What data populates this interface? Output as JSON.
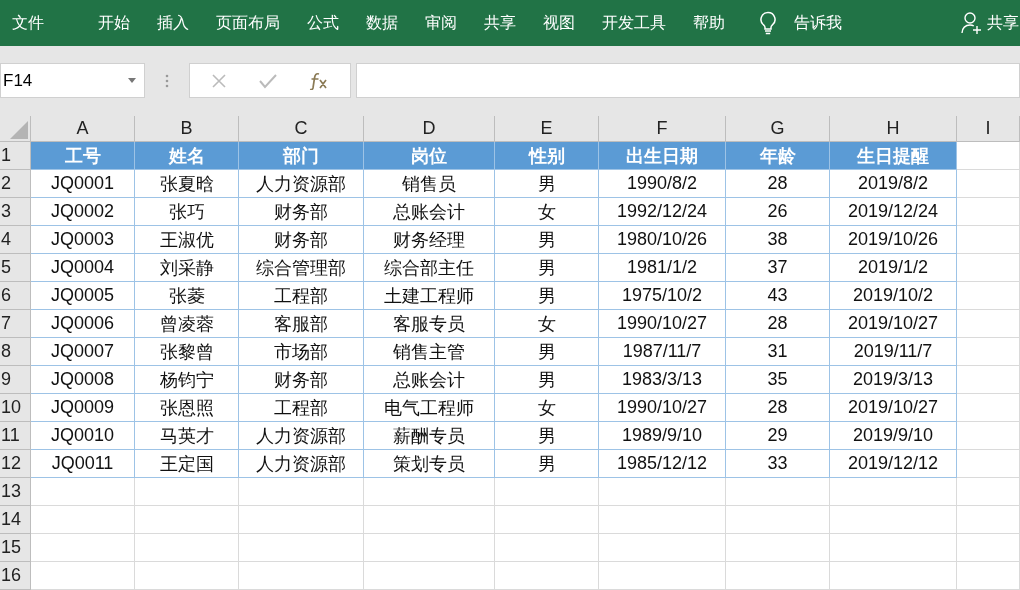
{
  "ribbon": {
    "tabs": [
      "文件",
      "开始",
      "插入",
      "页面布局",
      "公式",
      "数据",
      "审阅",
      "共享",
      "视图",
      "开发工具",
      "帮助"
    ],
    "tell_me": "告诉我",
    "share": "共享"
  },
  "name_box": "F14",
  "column_letters": [
    "A",
    "B",
    "C",
    "D",
    "E",
    "F",
    "G",
    "H",
    "I"
  ],
  "row_numbers": [
    "1",
    "2",
    "3",
    "4",
    "5",
    "6",
    "7",
    "8",
    "9",
    "10",
    "11",
    "12",
    "13",
    "14",
    "15",
    "16"
  ],
  "table": {
    "header": [
      "工号",
      "姓名",
      "部门",
      "岗位",
      "性别",
      "出生日期",
      "年龄",
      "生日提醒"
    ],
    "rows": [
      [
        "JQ0001",
        "张夏晗",
        "人力资源部",
        "销售员",
        "男",
        "1990/8/2",
        "28",
        "2019/8/2"
      ],
      [
        "JQ0002",
        "张巧",
        "财务部",
        "总账会计",
        "女",
        "1992/12/24",
        "26",
        "2019/12/24"
      ],
      [
        "JQ0003",
        "王淑优",
        "财务部",
        "财务经理",
        "男",
        "1980/10/26",
        "38",
        "2019/10/26"
      ],
      [
        "JQ0004",
        "刘采静",
        "综合管理部",
        "综合部主任",
        "男",
        "1981/1/2",
        "37",
        "2019/1/2"
      ],
      [
        "JQ0005",
        "张菱",
        "工程部",
        "土建工程师",
        "男",
        "1975/10/2",
        "43",
        "2019/10/2"
      ],
      [
        "JQ0006",
        "曾凌蓉",
        "客服部",
        "客服专员",
        "女",
        "1990/10/27",
        "28",
        "2019/10/27"
      ],
      [
        "JQ0007",
        "张黎曾",
        "市场部",
        "销售主管",
        "男",
        "1987/11/7",
        "31",
        "2019/11/7"
      ],
      [
        "JQ0008",
        "杨钧宁",
        "财务部",
        "总账会计",
        "男",
        "1983/3/13",
        "35",
        "2019/3/13"
      ],
      [
        "JQ0009",
        "张恩照",
        "工程部",
        "电气工程师",
        "女",
        "1990/10/27",
        "28",
        "2019/10/27"
      ],
      [
        "JQ0010",
        "马英才",
        "人力资源部",
        "薪酬专员",
        "男",
        "1989/9/10",
        "29",
        "2019/9/10"
      ],
      [
        "JQ0011",
        "王定国",
        "人力资源部",
        "策划专员",
        "男",
        "1985/12/12",
        "33",
        "2019/12/12"
      ]
    ]
  }
}
